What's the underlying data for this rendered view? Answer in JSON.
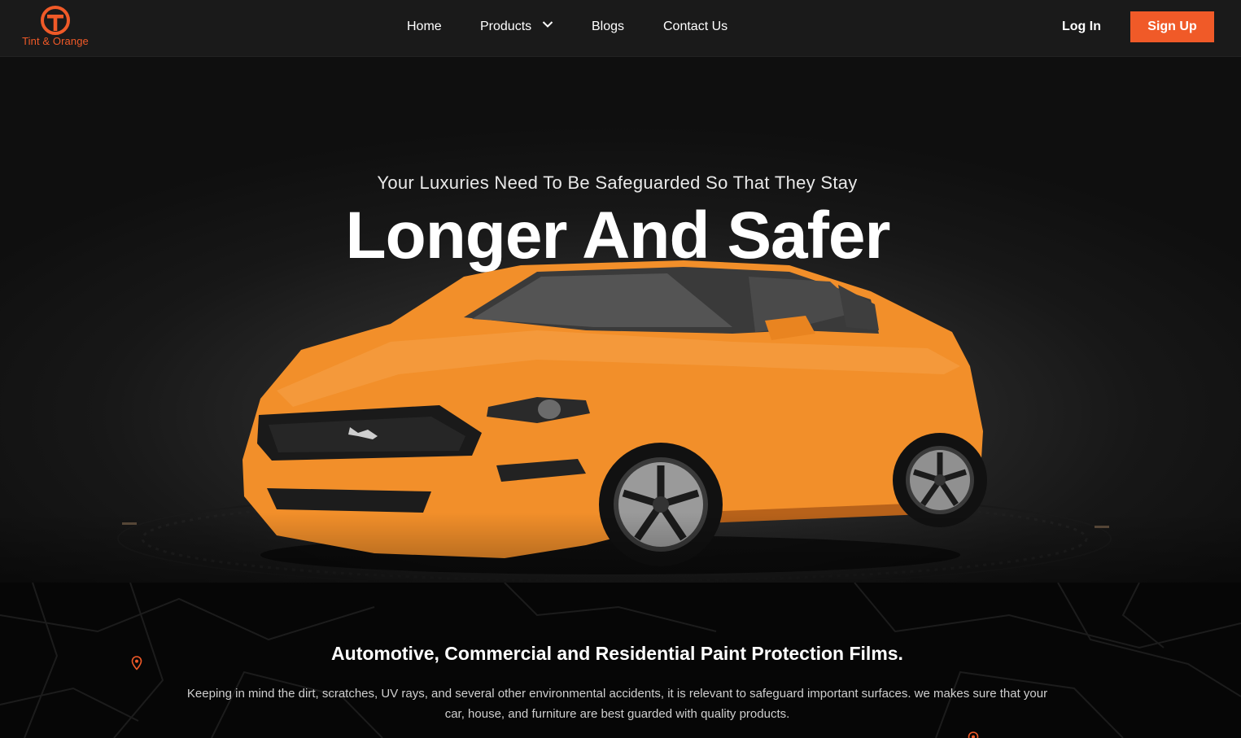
{
  "brand": {
    "name": "Tint & Orange",
    "accent": "#f05a28"
  },
  "nav": {
    "links": [
      {
        "label": "Home"
      },
      {
        "label": "Products",
        "icon": "chevron-down-icon"
      },
      {
        "label": "Blogs"
      },
      {
        "label": "Contact Us"
      }
    ],
    "login_label": "Log In",
    "signup_label": "Sign Up"
  },
  "hero": {
    "subtitle": "Your Luxuries Need To Be Safeguarded So That They Stay",
    "title": "Longer And Safer",
    "car_color": "#f28f2a"
  },
  "features": {
    "title": "Automotive, Commercial and Residential Paint Protection Films.",
    "description": "Keeping in mind the dirt, scratches, UV rays, and several other environmental accidents, it is relevant to safeguard important surfaces. we makes sure that your car, house, and furniture are best guarded with quality products.",
    "icons": [
      "map-pin-icon",
      "map-pin-icon"
    ]
  }
}
